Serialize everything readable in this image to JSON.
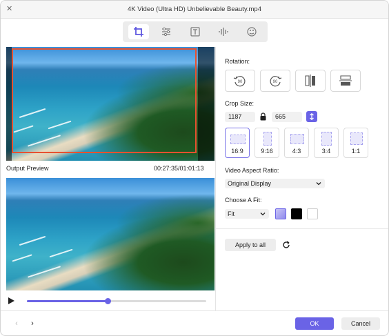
{
  "window": {
    "title": "4K Video (Ultra HD) Unbelievable Beauty.mp4",
    "close_glyph": "✕"
  },
  "toolbar": {
    "tools": [
      {
        "icon": "crop-icon",
        "active": true
      },
      {
        "icon": "sliders-icon",
        "active": false
      },
      {
        "icon": "text-icon",
        "active": false
      },
      {
        "icon": "audio-icon",
        "active": false
      },
      {
        "icon": "watermark-icon",
        "active": false
      }
    ]
  },
  "preview": {
    "label": "Output Preview",
    "time": "00:27:35/01:01:13",
    "progress": 0.45
  },
  "rotation": {
    "label": "Rotation:",
    "buttons": [
      {
        "icon": "rotate-left-90-icon",
        "text": "90"
      },
      {
        "icon": "rotate-right-90-icon",
        "text": "90"
      },
      {
        "icon": "flip-horizontal-icon"
      },
      {
        "icon": "flip-vertical-icon"
      }
    ]
  },
  "crop": {
    "label": "Crop Size:",
    "width": "1187",
    "height": "665",
    "ratios": [
      {
        "label": "16:9",
        "active": true
      },
      {
        "label": "9:16",
        "active": false
      },
      {
        "label": "4:3",
        "active": false
      },
      {
        "label": "3:4",
        "active": false
      },
      {
        "label": "1:1",
        "active": false
      }
    ]
  },
  "aspect": {
    "label": "Video Aspect Ratio:",
    "selected": "Original Display"
  },
  "fit": {
    "label": "Choose A Fit:",
    "selected": "Fit",
    "colors": [
      "#8f89ec",
      "#000000",
      "#ffffff"
    ]
  },
  "actions": {
    "apply_all": "Apply to all",
    "ok": "OK",
    "cancel": "Cancel",
    "prev_glyph": "‹",
    "next_glyph": "›"
  },
  "accent": "#6a63e6",
  "crop_border": "#e8512f"
}
